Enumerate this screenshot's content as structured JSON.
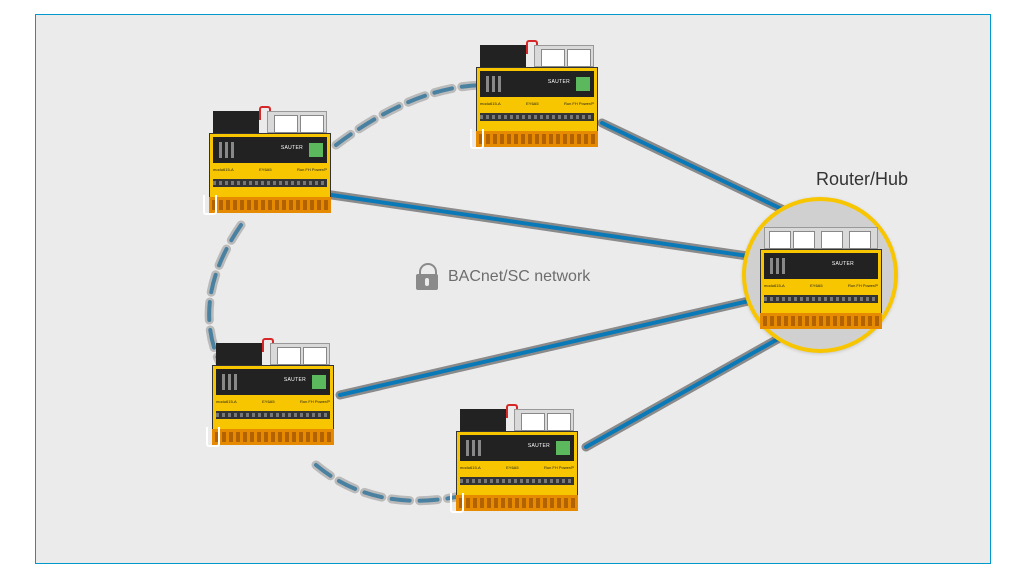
{
  "diagram": {
    "center_label": "BACnet/SC network",
    "hub_label": "Router/Hub"
  },
  "device": {
    "brand": "SAUTER",
    "row1_left": "modu615-A",
    "row1_mid": "EY6A5",
    "row1_right": "Run   FH   Power/P",
    "panel_txt": "SAUTER"
  }
}
